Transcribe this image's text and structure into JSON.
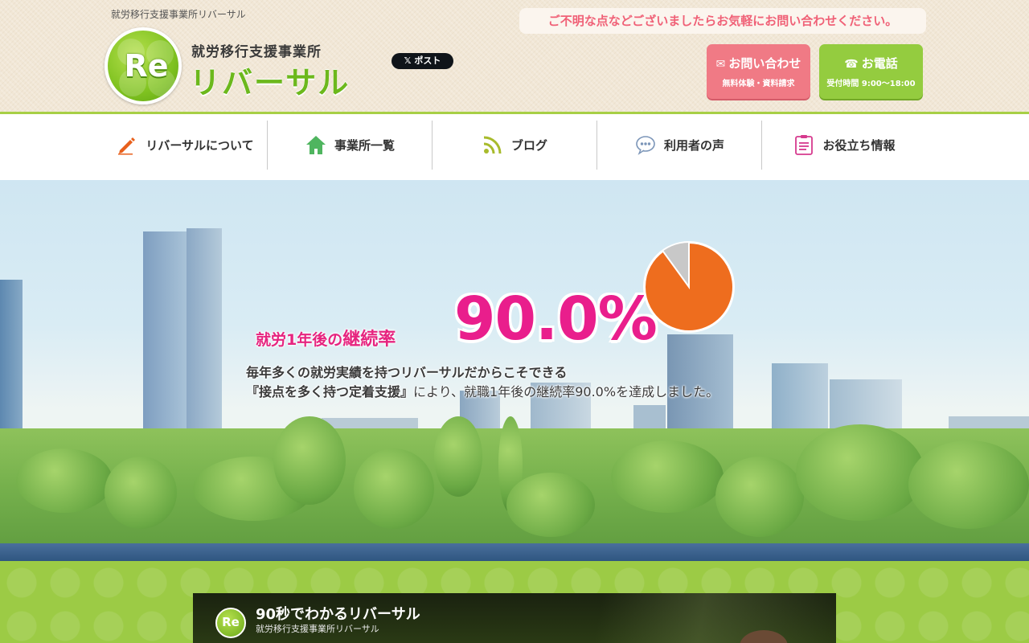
{
  "header": {
    "tagline": "就労移行支援事業所リバーサル",
    "logo": {
      "badge": "Re",
      "sub": "就労移行支援事業所",
      "main": "リバーサル"
    },
    "x_post": "𝕏 ポスト",
    "notice": "ご不明な点などございましたらお気軽にお問い合わせください。",
    "contact": {
      "label": "お問い合わせ",
      "sub": "無料体験・資料請求"
    },
    "phone": {
      "label": "お電話",
      "sub": "受付時間 9:00〜18:00"
    }
  },
  "nav": {
    "items": [
      {
        "label": "リバーサルについて",
        "icon": "pencil-icon"
      },
      {
        "label": "事業所一覧",
        "icon": "house-icon"
      },
      {
        "label": "ブログ",
        "icon": "rss-icon"
      },
      {
        "label": "利用者の声",
        "icon": "speech-bubble-icon"
      },
      {
        "label": "お役立ち情報",
        "icon": "clipboard-icon"
      }
    ]
  },
  "hero": {
    "pre": "就労1年後の",
    "pre_emph": "継続率",
    "rate": "90.0%",
    "rate_value": 90.0,
    "line1": "毎年多くの就労実績を持つリバーサルだからこそできる",
    "line2_strong": "『接点を多く持つ定着支援』",
    "line2_rest": "により、就職1年後の継続率90.0%を達成しました。"
  },
  "video": {
    "badge": "Re",
    "title": "90秒でわかるリバーサル",
    "subtitle": "就労移行支援事業所リバーサル"
  },
  "colors": {
    "brand_green": "#7fc220",
    "accent_pink": "#e91e8c",
    "contact_pink": "#f07a85",
    "pie_orange": "#ee6d1e"
  }
}
